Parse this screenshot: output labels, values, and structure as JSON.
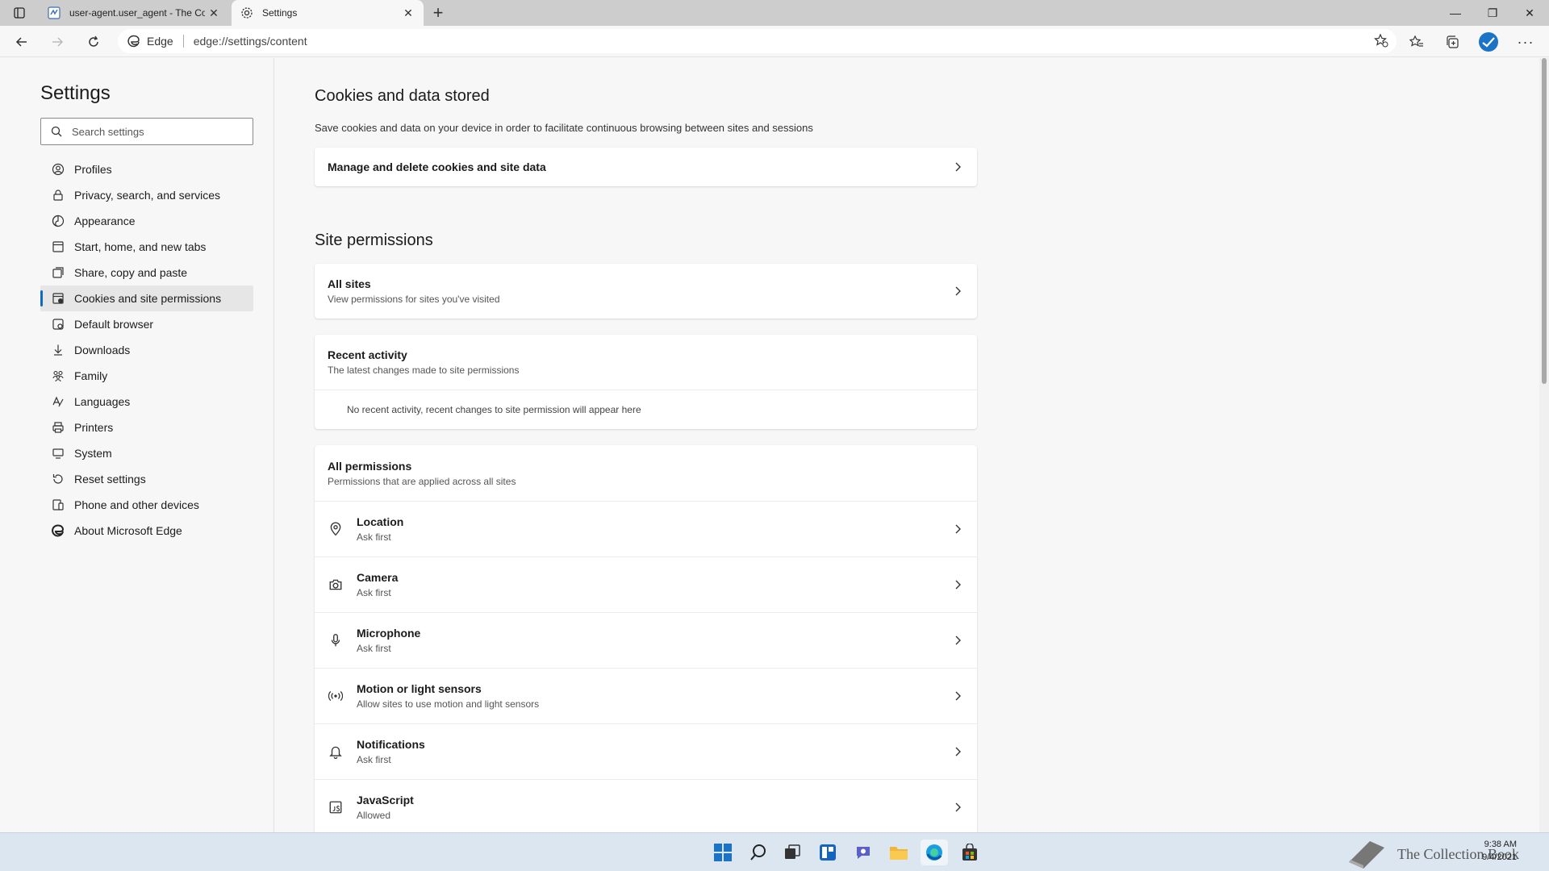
{
  "browser": {
    "tabs": [
      {
        "label": "user-agent.user_agent - The Coll",
        "active": false
      },
      {
        "label": "Settings",
        "active": true
      }
    ],
    "address": {
      "badge": "Edge",
      "url": "edge://settings/content"
    }
  },
  "sidebar": {
    "title": "Settings",
    "search_placeholder": "Search settings",
    "items": [
      {
        "label": "Profiles",
        "icon": "profile-icon"
      },
      {
        "label": "Privacy, search, and services",
        "icon": "lock-icon"
      },
      {
        "label": "Appearance",
        "icon": "appearance-icon"
      },
      {
        "label": "Start, home, and new tabs",
        "icon": "start-icon"
      },
      {
        "label": "Share, copy and paste",
        "icon": "share-icon"
      },
      {
        "label": "Cookies and site permissions",
        "icon": "cookies-icon",
        "active": true
      },
      {
        "label": "Default browser",
        "icon": "browser-icon"
      },
      {
        "label": "Downloads",
        "icon": "download-icon"
      },
      {
        "label": "Family",
        "icon": "family-icon"
      },
      {
        "label": "Languages",
        "icon": "languages-icon"
      },
      {
        "label": "Printers",
        "icon": "printer-icon"
      },
      {
        "label": "System",
        "icon": "system-icon"
      },
      {
        "label": "Reset settings",
        "icon": "reset-icon"
      },
      {
        "label": "Phone and other devices",
        "icon": "phone-icon"
      },
      {
        "label": "About Microsoft Edge",
        "icon": "edge-icon"
      }
    ]
  },
  "main": {
    "cookies": {
      "heading": "Cookies and data stored",
      "description": "Save cookies and data on your device in order to facilitate continuous browsing between sites and sessions",
      "manage_label": "Manage and delete cookies and site data"
    },
    "site_permissions": {
      "heading": "Site permissions",
      "all_sites": {
        "title": "All sites",
        "subtitle": "View permissions for sites you've visited"
      },
      "recent": {
        "title": "Recent activity",
        "subtitle": "The latest changes made to site permissions",
        "empty": "No recent activity, recent changes to site permission will appear here"
      },
      "all_permissions": {
        "title": "All permissions",
        "subtitle": "Permissions that are applied across all sites"
      },
      "permissions": [
        {
          "title": "Location",
          "subtitle": "Ask first",
          "icon": "location-icon"
        },
        {
          "title": "Camera",
          "subtitle": "Ask first",
          "icon": "camera-icon"
        },
        {
          "title": "Microphone",
          "subtitle": "Ask first",
          "icon": "microphone-icon"
        },
        {
          "title": "Motion or light sensors",
          "subtitle": "Allow sites to use motion and light sensors",
          "icon": "sensors-icon"
        },
        {
          "title": "Notifications",
          "subtitle": "Ask first",
          "icon": "bell-icon"
        },
        {
          "title": "JavaScript",
          "subtitle": "Allowed",
          "icon": "javascript-icon"
        }
      ]
    }
  },
  "taskbar": {
    "time": "9:38 AM",
    "date": "9/4/2021",
    "watermark": "The Collection Book"
  },
  "colors": {
    "accent": "#0f6cbd",
    "taskbar": "#dce6f0",
    "tabstrip": "#cdcdcd"
  }
}
